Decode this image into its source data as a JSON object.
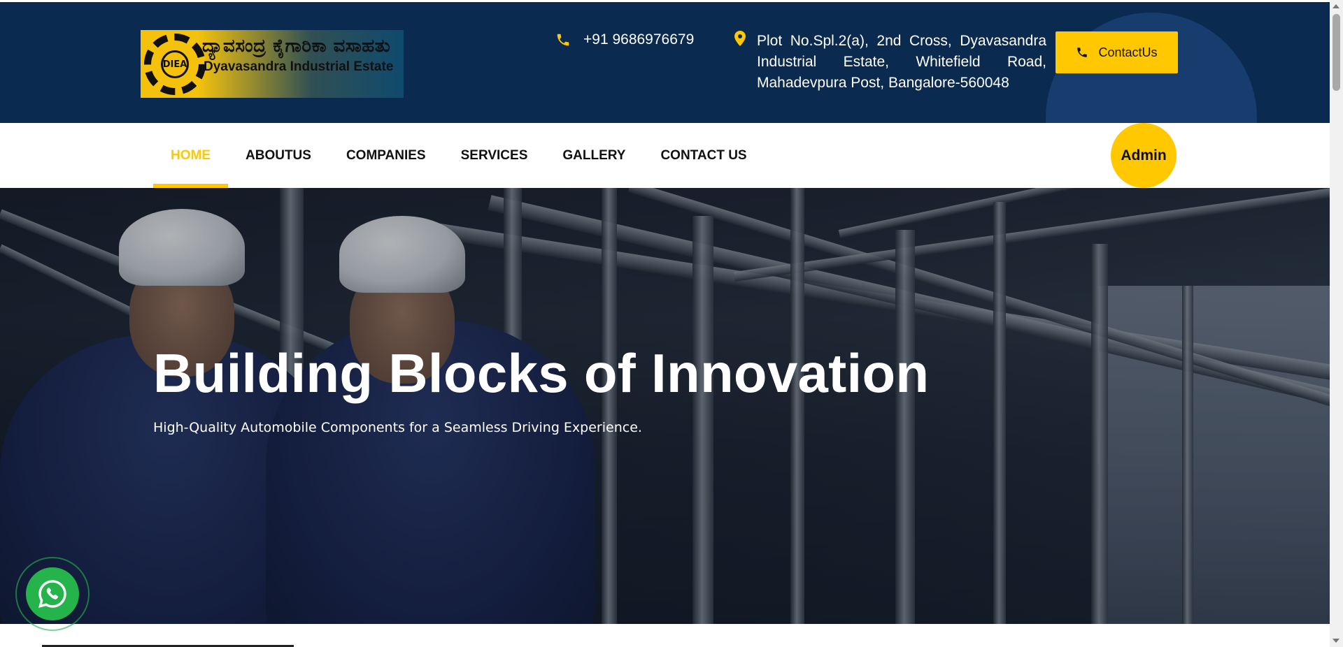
{
  "header": {
    "logo": {
      "kannada_text": "ದ್ಯಾವಸಂದ್ರ ಕೈಗಾರಿಕಾ ವಸಾಹತು",
      "english_text": "Dyavasandra Industrial Estate",
      "emblem_text": "DIEA"
    },
    "phone": "+91 9686976679",
    "address": "Plot No.Spl.2(a), 2nd Cross, Dyavasandra Industrial Estate, Whitefield Road, Mahadevpura Post, Bangalore-560048",
    "contact_button": "ContactUs",
    "icons": {
      "phone": "phone-icon",
      "location": "location-pin-icon"
    }
  },
  "nav": {
    "items": [
      {
        "label": "HOME",
        "active": true
      },
      {
        "label": "ABOUTUS",
        "active": false
      },
      {
        "label": "COMPANIES",
        "active": false
      },
      {
        "label": "SERVICES",
        "active": false
      },
      {
        "label": "GALLERY",
        "active": false
      },
      {
        "label": "CONTACT US",
        "active": false
      }
    ],
    "admin_button": "Admin"
  },
  "hero": {
    "title": "Building Blocks of Innovation",
    "subtitle": "High-Quality Automobile Components for a Seamless Driving Experience."
  },
  "floating": {
    "whatsapp_icon": "whatsapp-icon"
  },
  "colors": {
    "header_bg": "#0b2a4f",
    "accent": "#ffc800",
    "whatsapp": "#25b34b"
  }
}
